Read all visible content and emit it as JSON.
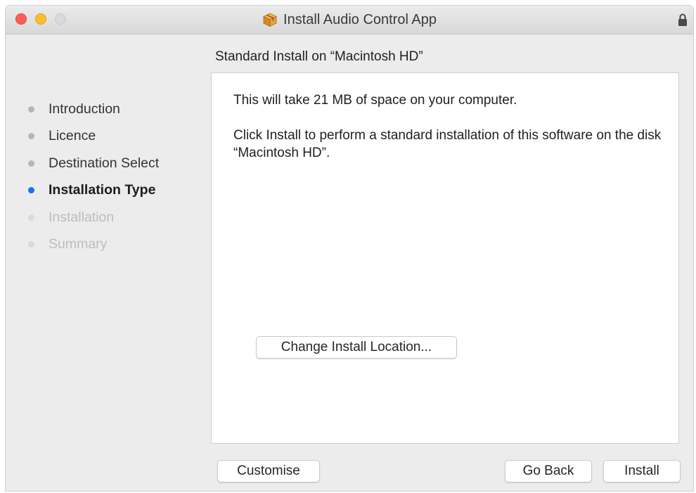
{
  "window": {
    "title": "Install Audio Control App"
  },
  "icons": {
    "close": "close-traffic-light",
    "minimize": "minimize-traffic-light",
    "zoom": "zoom-traffic-light",
    "package": "package-icon",
    "lock": "lock-icon"
  },
  "colors": {
    "close": "#fd5f57",
    "minimize": "#fdbc2e",
    "zoom_disabled": "#d9d9d9",
    "current_step": "#1a73e8"
  },
  "heading": "Standard Install on “Macintosh HD”",
  "steps": [
    {
      "label": "Introduction",
      "state": "done"
    },
    {
      "label": "Licence",
      "state": "done"
    },
    {
      "label": "Destination Select",
      "state": "done"
    },
    {
      "label": "Installation Type",
      "state": "current"
    },
    {
      "label": "Installation",
      "state": "future"
    },
    {
      "label": "Summary",
      "state": "future"
    }
  ],
  "content": {
    "space_text": "This will take 21 MB of space on your computer.",
    "instruction_text": "Click Install to perform a standard installation of this software on the disk “Macintosh HD”.",
    "change_location_label": "Change Install Location..."
  },
  "buttons": {
    "customise": "Customise",
    "go_back": "Go Back",
    "install": "Install"
  }
}
